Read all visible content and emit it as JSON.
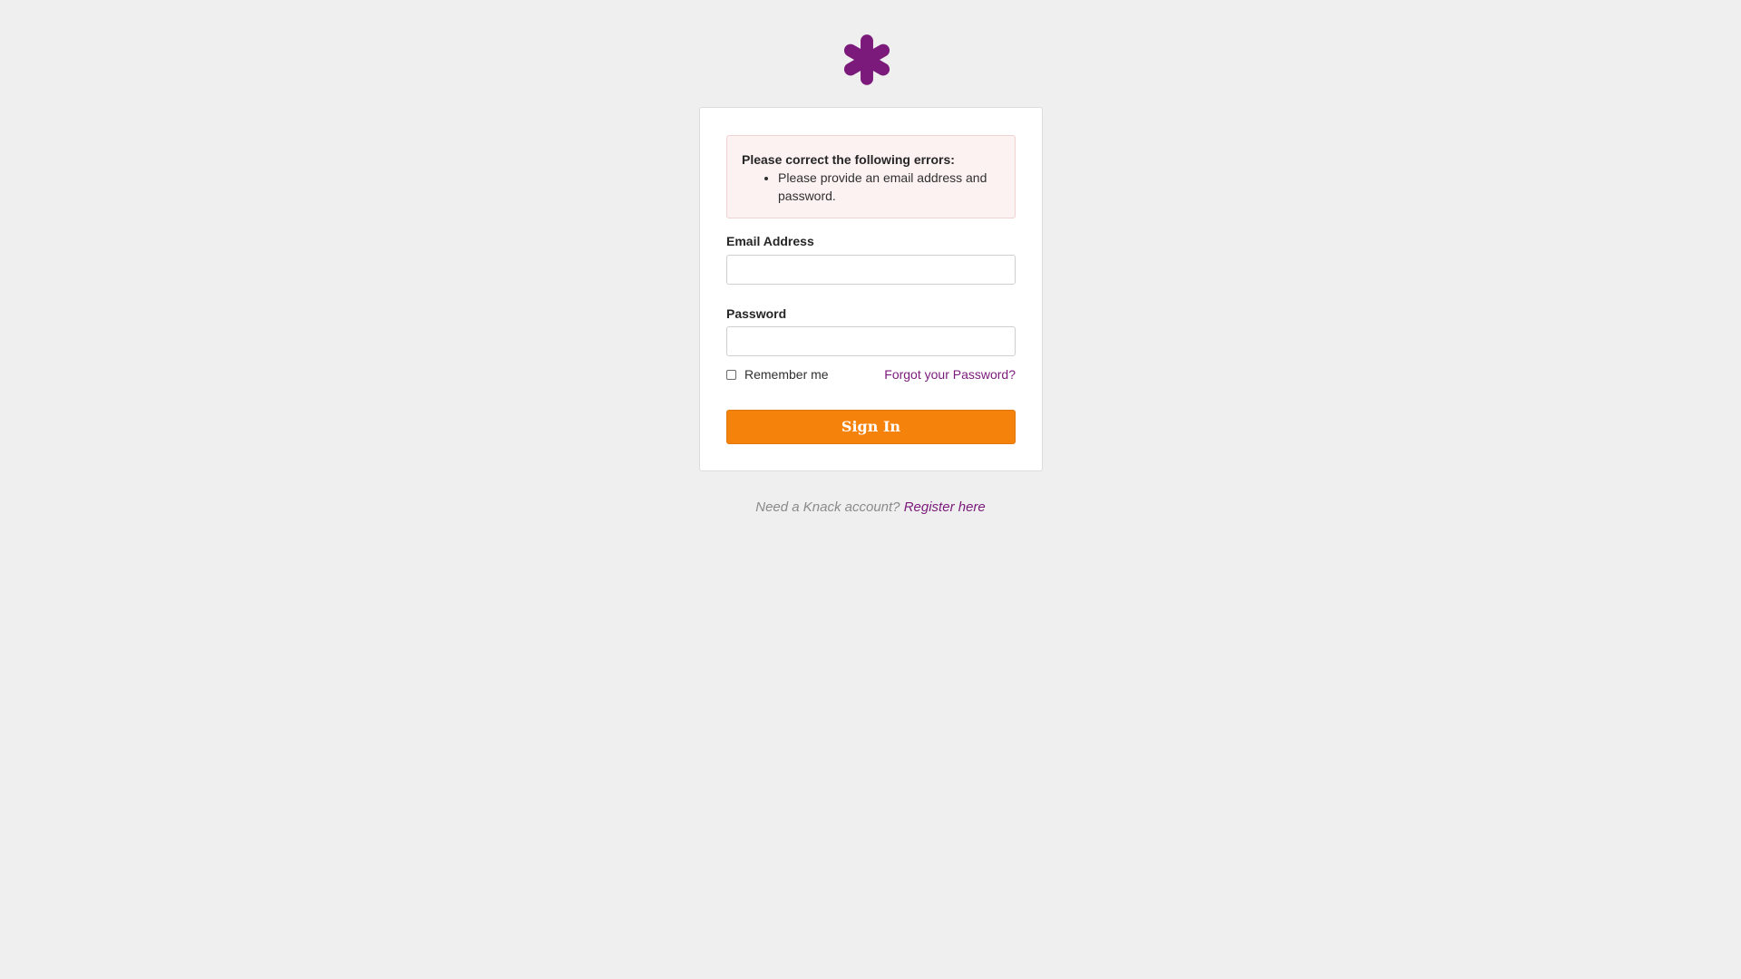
{
  "brand": {
    "logo_icon": "asterisk-logo",
    "logo_color": "#7b1a7b",
    "accent_color": "#f5820b"
  },
  "error": {
    "title": "Please correct the following errors:",
    "items": [
      "Please provide an email address and password."
    ]
  },
  "form": {
    "email_label": "Email Address",
    "email_value": "",
    "password_label": "Password",
    "password_value": "",
    "remember_label": "Remember me",
    "remember_checked": false,
    "forgot_link": "Forgot your Password?",
    "submit_label": "Sign In"
  },
  "footer": {
    "prompt": "Need a Knack account?",
    "register_link": "Register here"
  }
}
